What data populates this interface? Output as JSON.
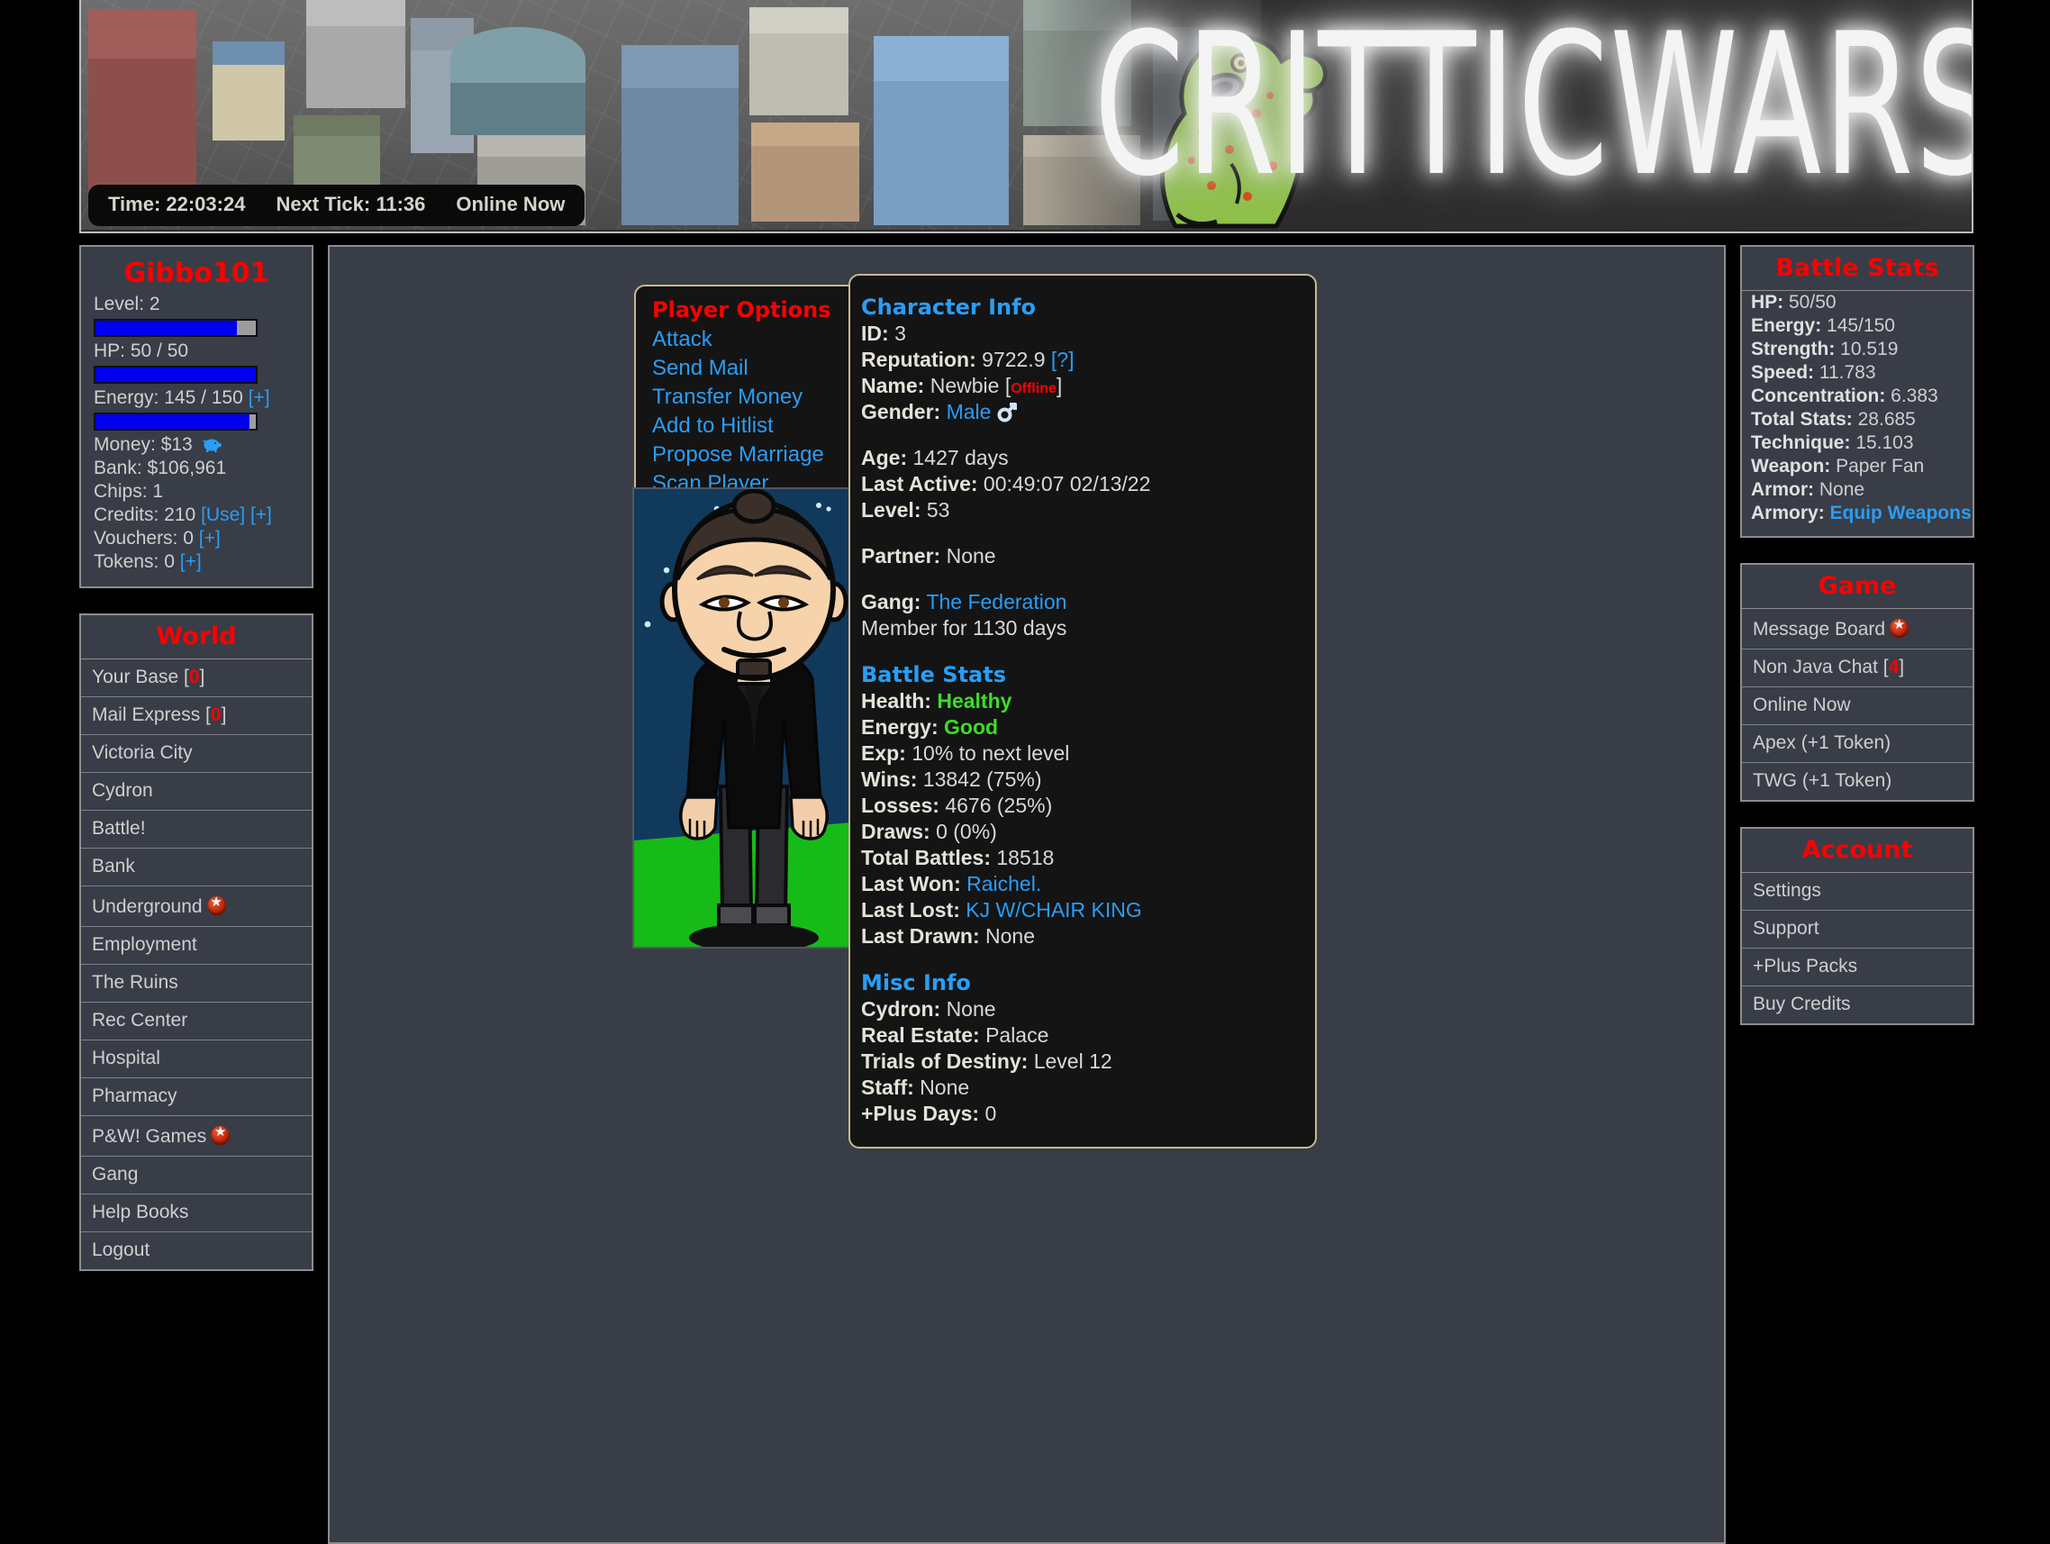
{
  "banner": {
    "logo_text": "CRITTICWARS",
    "status": {
      "time_label": "Time: 22:03:24",
      "tick_label": "Next Tick: 11:36",
      "online_label": "Online Now"
    }
  },
  "player": {
    "name": "Gibbo101",
    "level_label": "Level: 2",
    "level_pct": 88,
    "hp_label": "HP: 50 / 50",
    "hp_pct": 100,
    "energy_label": "Energy: 145 / 150",
    "energy_plus": "[+]",
    "energy_pct": 96,
    "money_label": "Money: $13",
    "bank_label": "Bank: $106,961",
    "chips_label": "Chips: 1",
    "credits_prefix": "Credits: 210",
    "credits_use": "[Use]",
    "credits_plus": "[+]",
    "vouchers_prefix": "Vouchers: 0",
    "vouchers_plus": "[+]",
    "tokens_prefix": "Tokens: 0",
    "tokens_plus": "[+]"
  },
  "world": {
    "title": "World",
    "items": [
      {
        "label": "Your Base",
        "count": "0",
        "star": false
      },
      {
        "label": "Mail Express",
        "count": "0",
        "star": false
      },
      {
        "label": "Victoria City",
        "count": "",
        "star": false
      },
      {
        "label": "Cydron",
        "count": "",
        "star": false
      },
      {
        "label": "Battle!",
        "count": "",
        "star": false
      },
      {
        "label": "Bank",
        "count": "",
        "star": false
      },
      {
        "label": "Underground",
        "count": "",
        "star": true
      },
      {
        "label": "Employment",
        "count": "",
        "star": false
      },
      {
        "label": "The Ruins",
        "count": "",
        "star": false
      },
      {
        "label": "Rec Center",
        "count": "",
        "star": false
      },
      {
        "label": "Hospital",
        "count": "",
        "star": false
      },
      {
        "label": "Pharmacy",
        "count": "",
        "star": false
      },
      {
        "label": "P&W! Games",
        "count": "",
        "star": true
      },
      {
        "label": "Gang",
        "count": "",
        "star": false
      },
      {
        "label": "Help Books",
        "count": "",
        "star": false
      },
      {
        "label": "Logout",
        "count": "",
        "star": false
      }
    ]
  },
  "player_options": {
    "title": "Player Options",
    "items": [
      "Attack",
      "Send Mail",
      "Transfer Money",
      "Add to Hitlist",
      "Propose Marriage",
      "Scan Player"
    ]
  },
  "character": {
    "info_title": "Character Info",
    "id_label": "ID:",
    "id_value": "3",
    "rep_label": "Reputation:",
    "rep_value": "9722.9",
    "rep_help": "[?]",
    "name_label": "Name:",
    "name_value": "Newbie",
    "name_status": "Offline",
    "gender_label": "Gender:",
    "gender_value": "Male",
    "age_label": "Age:",
    "age_value": "1427 days",
    "last_active_label": "Last Active:",
    "last_active_value": "00:49:07 02/13/22",
    "level_label": "Level:",
    "level_value": "53",
    "partner_label": "Partner:",
    "partner_value": "None",
    "gang_label": "Gang:",
    "gang_value": "The Federation",
    "gang_member_for": "Member for 1130 days",
    "battle_title": "Battle Stats",
    "health_label": "Health:",
    "health_value": "Healthy",
    "energy_label": "Energy:",
    "energy_value": "Good",
    "exp_label": "Exp:",
    "exp_value": "10% to next level",
    "wins_label": "Wins:",
    "wins_value": "13842 (75%)",
    "losses_label": "Losses:",
    "losses_value": "4676 (25%)",
    "draws_label": "Draws:",
    "draws_value": "0 (0%)",
    "total_label": "Total Battles:",
    "total_value": "18518",
    "last_won_label": "Last Won:",
    "last_won_value": "Raichel.",
    "last_lost_label": "Last Lost:",
    "last_lost_value": "KJ W/CHAIR KING",
    "last_drawn_label": "Last Drawn:",
    "last_drawn_value": "None",
    "misc_title": "Misc Info",
    "cydron_label": "Cydron:",
    "cydron_value": "None",
    "real_estate_label": "Real Estate:",
    "real_estate_value": "Palace",
    "trials_label": "Trials of Destiny:",
    "trials_value": "Level 12",
    "staff_label": "Staff:",
    "staff_value": "None",
    "plus_days_label": "+Plus Days:",
    "plus_days_value": "0"
  },
  "battle_stats": {
    "title": "Battle Stats",
    "rows": [
      {
        "label": "HP:",
        "value": "50/50",
        "link": false
      },
      {
        "label": "Energy:",
        "value": "145/150",
        "link": false
      },
      {
        "label": "Strength:",
        "value": "10.519",
        "link": false
      },
      {
        "label": "Speed:",
        "value": "11.783",
        "link": false
      },
      {
        "label": "Concentration:",
        "value": "6.383",
        "link": false
      },
      {
        "label": "Total Stats:",
        "value": "28.685",
        "link": false
      },
      {
        "label": "Technique:",
        "value": "15.103",
        "link": false
      },
      {
        "label": "Weapon:",
        "value": "Paper Fan",
        "link": false
      },
      {
        "label": "Armor:",
        "value": "None",
        "link": false
      },
      {
        "label": "Armory:",
        "value": "Equip Weapons",
        "link": true
      }
    ]
  },
  "game": {
    "title": "Game",
    "items": [
      {
        "label": "Message Board",
        "count": "",
        "star": true
      },
      {
        "label": "Non Java Chat",
        "count": "4",
        "star": false
      },
      {
        "label": "Online Now",
        "count": "",
        "star": false
      },
      {
        "label": "Apex (+1 Token)",
        "count": "",
        "star": false
      },
      {
        "label": "TWG (+1 Token)",
        "count": "",
        "star": false
      }
    ]
  },
  "account": {
    "title": "Account",
    "items": [
      {
        "label": "Settings",
        "count": "",
        "star": false
      },
      {
        "label": "Support",
        "count": "",
        "star": false
      },
      {
        "label": "+Plus Packs",
        "count": "",
        "star": false
      },
      {
        "label": "Buy Credits",
        "count": "",
        "star": false
      }
    ]
  },
  "colors": {
    "accent_red": "#ff0000",
    "link_blue": "#2a9df4",
    "good_green": "#3cdc28",
    "panel_bg": "#383d47",
    "card_bg": "#141414",
    "card_border": "#c8b88e"
  }
}
